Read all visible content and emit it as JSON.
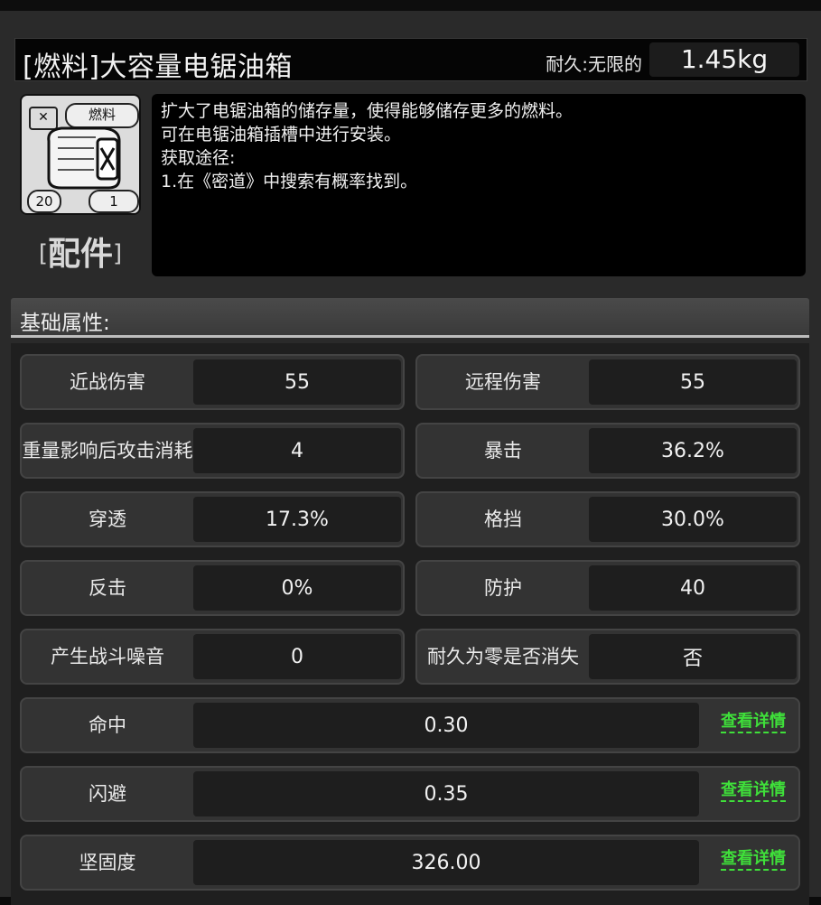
{
  "header": {
    "title": "[燃料]大容量电锯油箱",
    "durability_label": "耐久:无限的",
    "weight": "1.45kg"
  },
  "icon": {
    "tag": "燃料",
    "count_left": "20",
    "count_right": "1"
  },
  "category": {
    "open": "[",
    "label": "配件",
    "close": "]"
  },
  "description": [
    "扩大了电锯油箱的储存量，使得能够储存更多的燃料。",
    "可在电锯油箱插槽中进行安装。",
    "获取途径:",
    "1.在《密道》中搜索有概率找到。"
  ],
  "section": {
    "title": "基础属性:"
  },
  "stats": [
    {
      "label": "近战伤害",
      "value": "55"
    },
    {
      "label": "远程伤害",
      "value": "55"
    },
    {
      "label": "重量影响后攻击消耗",
      "value": "4"
    },
    {
      "label": "暴击",
      "value": "36.2%"
    },
    {
      "label": "穿透",
      "value": "17.3%"
    },
    {
      "label": "格挡",
      "value": "30.0%"
    },
    {
      "label": "反击",
      "value": "0%"
    },
    {
      "label": "防护",
      "value": "40"
    },
    {
      "label": "产生战斗噪音",
      "value": "0"
    },
    {
      "label": "耐久为零是否消失",
      "value": "否"
    }
  ],
  "wide_stats": [
    {
      "label": "命中",
      "value": "0.30",
      "link": "查看详情"
    },
    {
      "label": "闪避",
      "value": "0.35",
      "link": "查看详情"
    },
    {
      "label": "坚固度",
      "value": "326.00",
      "link": "查看详情"
    }
  ]
}
